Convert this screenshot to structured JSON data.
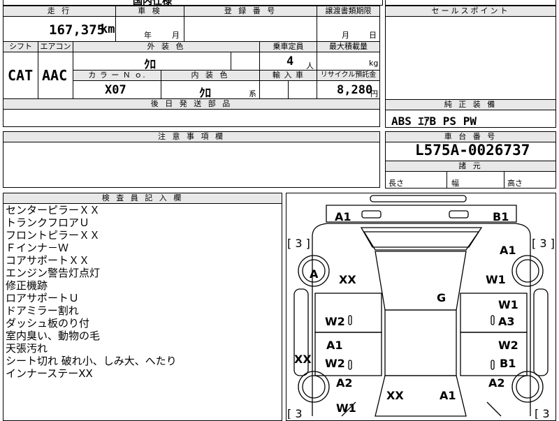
{
  "top_strip": {
    "partial_text": "国内仕様"
  },
  "mileage": {
    "header": "走 行",
    "value": "167,375",
    "unit": "km"
  },
  "inspection": {
    "header": "車 検",
    "year_label": "年",
    "month_label": "月"
  },
  "registration": {
    "header": "登 録 番 号"
  },
  "transfer_deadline": {
    "header": "譲渡書類期限",
    "month_label": "月",
    "day_label": "日"
  },
  "sales_points": {
    "header": "セールスポイント"
  },
  "shift": {
    "header": "シフト",
    "value": "CAT"
  },
  "aircon": {
    "header": "エアコン",
    "value": "AAC"
  },
  "exterior_color": {
    "header": "外 装 色",
    "value": "ｸﾛ"
  },
  "capacity": {
    "header": "乗車定員",
    "value": "4",
    "unit": "人"
  },
  "max_load": {
    "header": "最大積載量",
    "unit": "kg"
  },
  "color_no": {
    "header": "カ ラ ー Ｎ ｏ.",
    "value": "X07"
  },
  "interior_color": {
    "header": "内 装 色",
    "value": "ｸﾛ",
    "suffix": "系"
  },
  "import_car": {
    "header": "輸 入 車"
  },
  "recycle": {
    "header": "リサイクル預託金",
    "value": "8,280",
    "unit": "円"
  },
  "later_parts": {
    "header": "後 日 発 送 部 品"
  },
  "equipment": {
    "header": "純 正 装 備",
    "value": "ABS ｴｱB PS PW"
  },
  "caution": {
    "header": "注 意 事 項 欄"
  },
  "chassis": {
    "header": "車 台 番 号",
    "value": "L575A-0026737"
  },
  "dimensions": {
    "header": "諸 元",
    "length_label": "長さ",
    "width_label": "幅",
    "height_label": "高さ"
  },
  "inspector_notes": {
    "header": "検 査 員 記 入 欄",
    "lines": [
      "センターピラーＸＸ",
      "トランクフロアＵ",
      "フロントピラーＸＸ",
      "Ｆインナ－Ｗ",
      "コアサポートＸＸ",
      "エンジン警告灯点灯",
      "修正機跡",
      "ロアサポートＵ",
      "ドアミラー割れ",
      "ダッシュ板のり付",
      "室内臭い、動物の毛",
      "天張汚れ",
      "シート切れ 破れ小、しみ大、へたり",
      "インナーステーXX"
    ]
  },
  "diagram": {
    "bracket_left_top": "[ 3 ]",
    "bracket_right_top": "[ 3 ]",
    "bracket_left_bottom": "[ 3",
    "bracket_right_bottom": "[ 3",
    "codes": {
      "rear_bumper_left": "A1",
      "rear_bumper_right": "B1",
      "right_rear_quarter": "A1",
      "left_rear_wheel": "A",
      "left_rear_quarter": "XX",
      "right_rear_wheel_area": "W1",
      "roof": "G",
      "right_rear_door_top": "W1",
      "right_rear_door_bottom": "A3",
      "left_rear_door": "W2",
      "left_front_door_top": "A1",
      "left_front_door_bottom": "W2",
      "right_front_door_top": "W2",
      "right_front_door_bottom": "B1",
      "left_sill": "XX",
      "left_front_fender": "A2",
      "right_front_fender": "A2",
      "left_front_bottom": "W1",
      "hood_left": "XX",
      "hood_right": "A1"
    }
  }
}
